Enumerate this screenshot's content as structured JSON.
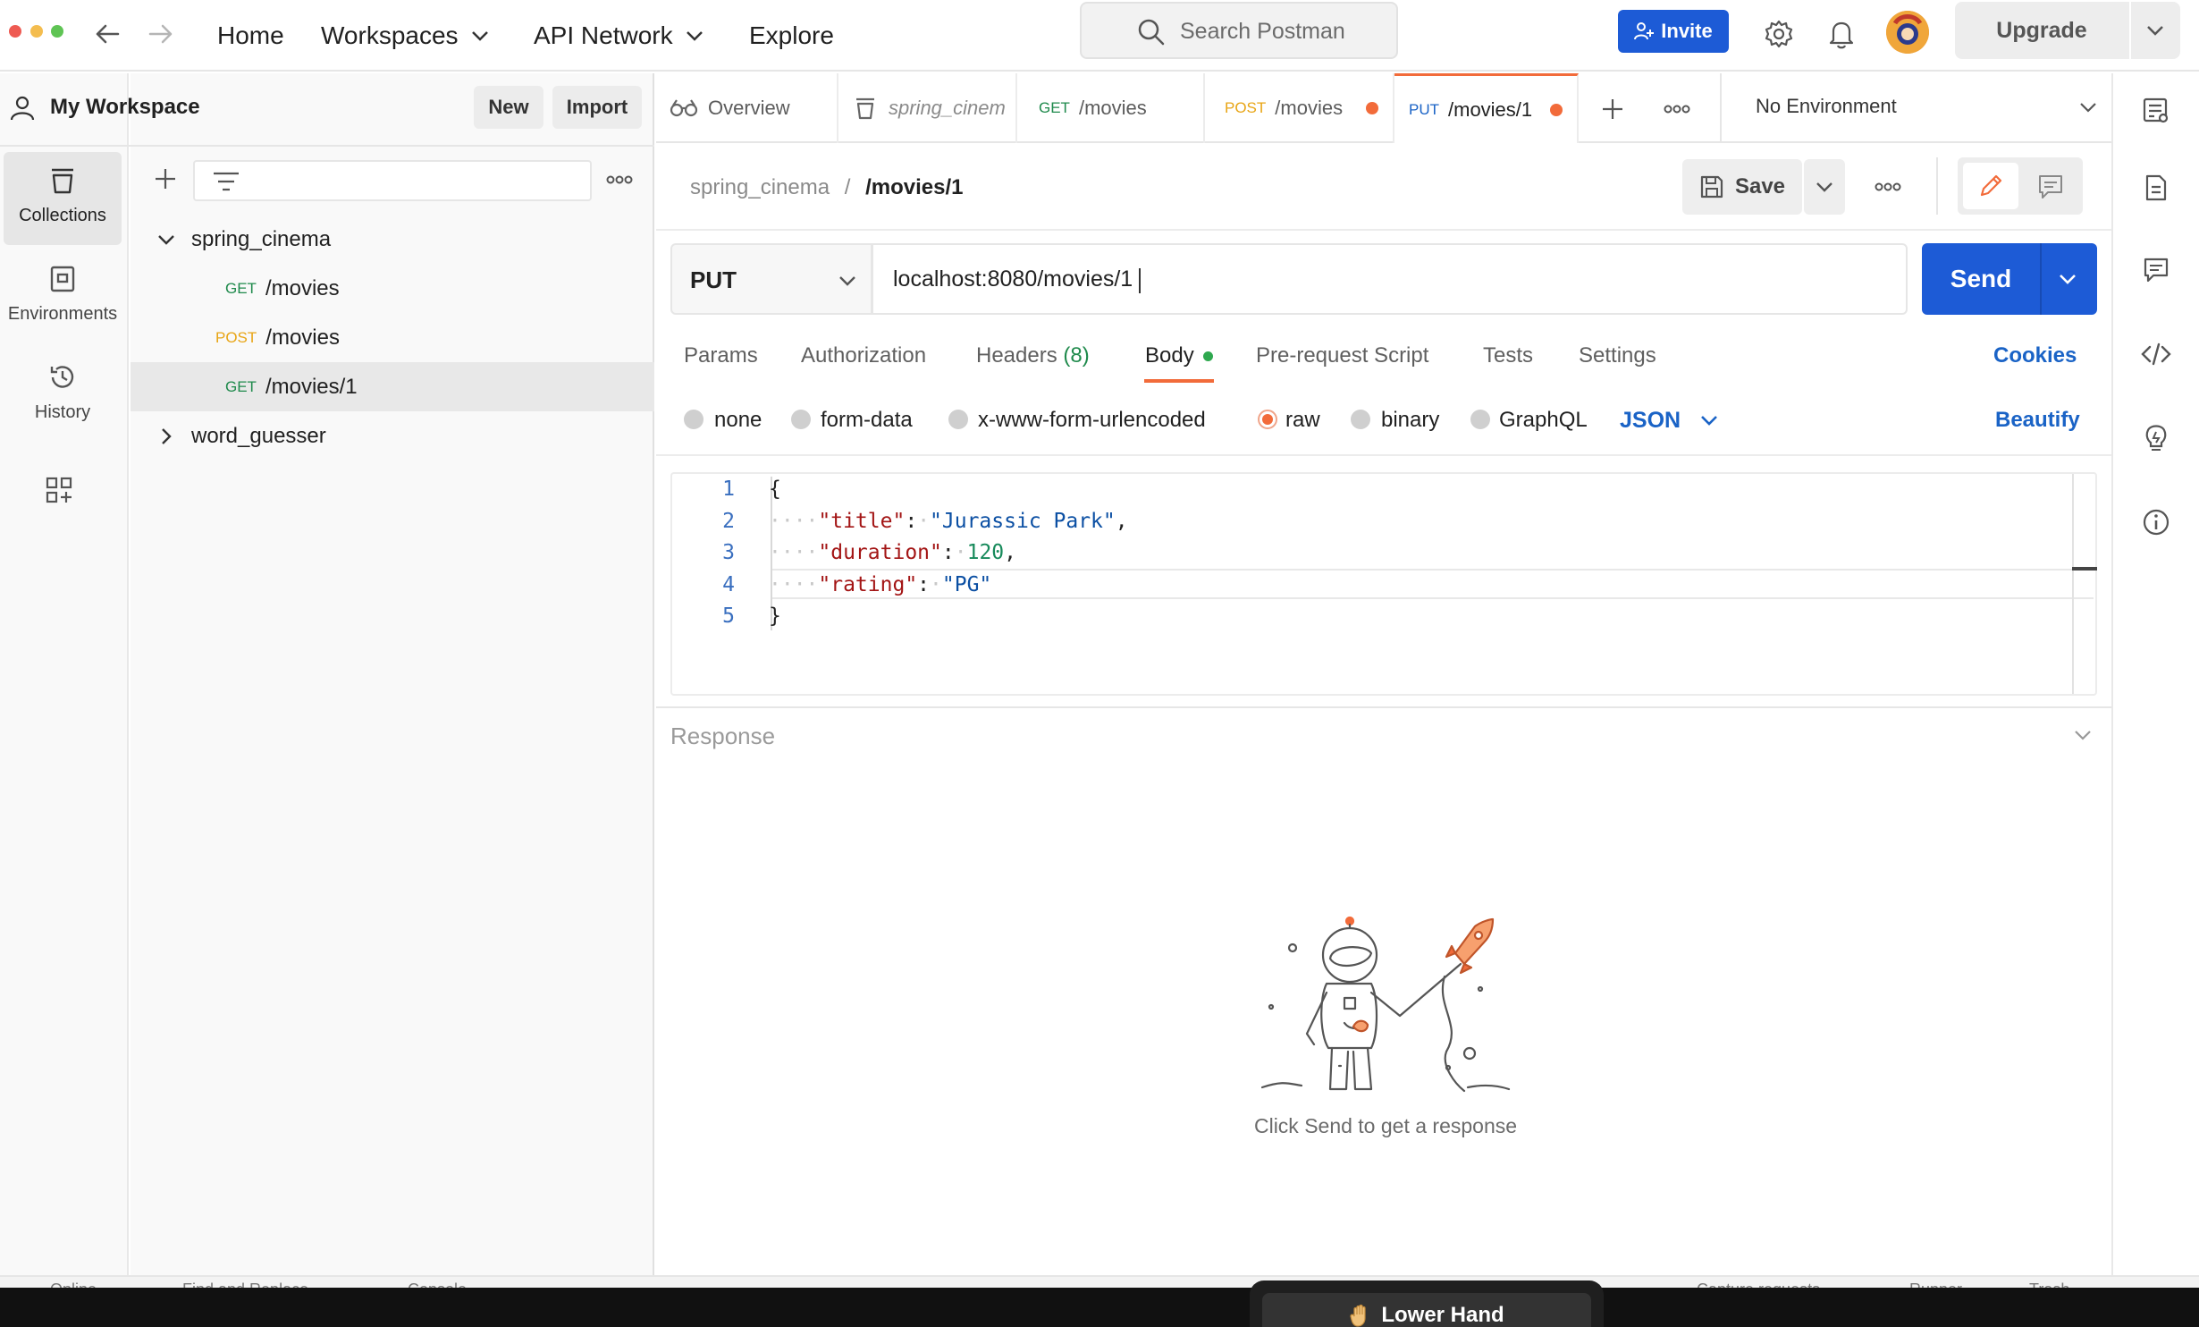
{
  "topbar": {
    "nav": {
      "home": "Home",
      "workspaces": "Workspaces",
      "api_network": "API Network",
      "explore": "Explore"
    },
    "search_placeholder": "Search Postman",
    "invite": "Invite",
    "upgrade": "Upgrade"
  },
  "rail": {
    "collections": "Collections",
    "environments": "Environments",
    "history": "History"
  },
  "sidebar": {
    "workspace": "My Workspace",
    "new": "New",
    "import": "Import",
    "collections": [
      {
        "name": "spring_cinema",
        "expanded": true,
        "requests": [
          {
            "method": "GET",
            "path": "/movies"
          },
          {
            "method": "POST",
            "path": "/movies"
          },
          {
            "method": "GET",
            "path": "/movies/1",
            "selected": true
          }
        ]
      },
      {
        "name": "word_guesser",
        "expanded": false
      }
    ]
  },
  "tabs": [
    {
      "label": "Overview",
      "icon": "overview-icon"
    },
    {
      "label": "spring_cinem",
      "icon": "collection-icon"
    },
    {
      "method": "GET",
      "label": "/movies"
    },
    {
      "method": "POST",
      "label": "/movies",
      "unsaved": true
    },
    {
      "method": "PUT",
      "label": "/movies/1",
      "unsaved": true,
      "active": true
    }
  ],
  "environment": "No Environment",
  "request": {
    "breadcrumb": {
      "collection": "spring_cinema",
      "separator": "/",
      "name": "/movies/1"
    },
    "save": "Save",
    "method": "PUT",
    "url": "localhost:8080/movies/1",
    "send": "Send",
    "tabs": {
      "params": "Params",
      "authorization": "Authorization",
      "headers": "Headers",
      "headers_count": "(8)",
      "body": "Body",
      "prerequest": "Pre-request Script",
      "tests": "Tests",
      "settings": "Settings"
    },
    "cookies": "Cookies",
    "body_types": {
      "none": "none",
      "form_data": "form-data",
      "urlencoded": "x-www-form-urlencoded",
      "raw": "raw",
      "binary": "binary",
      "graphql": "GraphQL"
    },
    "selected_body_type": "raw",
    "language": "JSON",
    "beautify": "Beautify",
    "line_numbers": [
      "1",
      "2",
      "3",
      "4",
      "5"
    ],
    "body": {
      "open": "{",
      "title_key": "\"title\"",
      "title_val": "\"Jurassic Park\"",
      "duration_key": "\"duration\"",
      "duration_val": "120",
      "rating_key": "\"rating\"",
      "rating_val": "\"PG\"",
      "close": "}"
    }
  },
  "response": {
    "title": "Response",
    "empty_message": "Click Send to get a response"
  },
  "statusbar": {
    "online": "Online",
    "find_replace": "Find and Replace",
    "console": "Console",
    "capture": "Capture requests",
    "runner": "Runner",
    "trash": "Trash"
  },
  "meeting": {
    "lower_hand": "Lower Hand"
  },
  "colors": {
    "accent": "#f26b3a",
    "primary": "#1d5bd6",
    "get": "#1f8a4c",
    "post": "#e8a515",
    "put": "#1a63c6"
  }
}
